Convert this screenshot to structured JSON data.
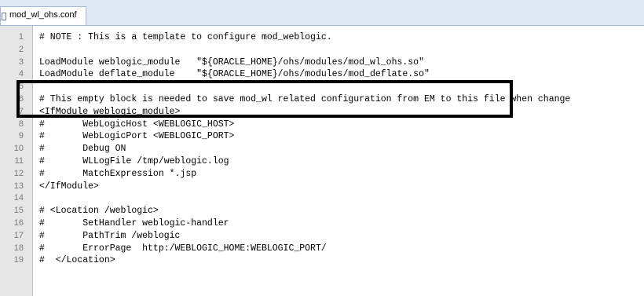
{
  "tab": {
    "icon": "file-icon",
    "label": "mod_wl_ohs.conf"
  },
  "lines": [
    {
      "num": "1",
      "text": "# NOTE : This is a template to configure mod_weblogic."
    },
    {
      "num": "2",
      "text": ""
    },
    {
      "num": "3",
      "text": "LoadModule weblogic_module   \"${ORACLE_HOME}/ohs/modules/mod_wl_ohs.so\""
    },
    {
      "num": "4",
      "text": "LoadModule deflate_module    \"${ORACLE_HOME}/ohs/modules/mod_deflate.so\""
    },
    {
      "num": "5",
      "text": ""
    },
    {
      "num": "6",
      "text": "# This empty block is needed to save mod_wl related configuration from EM to this file when change"
    },
    {
      "num": "7",
      "text": "<IfModule weblogic_module>"
    },
    {
      "num": "8",
      "text": "#       WebLogicHost <WEBLOGIC_HOST>"
    },
    {
      "num": "9",
      "text": "#       WebLogicPort <WEBLOGIC_PORT>"
    },
    {
      "num": "10",
      "text": "#       Debug ON"
    },
    {
      "num": "11",
      "text": "#       WLLogFile /tmp/weblogic.log"
    },
    {
      "num": "12",
      "text": "#       MatchExpression *.jsp"
    },
    {
      "num": "13",
      "text": "</IfModule>"
    },
    {
      "num": "14",
      "text": ""
    },
    {
      "num": "15",
      "text": "# <Location /weblogic>"
    },
    {
      "num": "16",
      "text": "#       SetHandler weblogic-handler"
    },
    {
      "num": "17",
      "text": "#       PathTrim /weblogic"
    },
    {
      "num": "18",
      "text": "#       ErrorPage  http:/WEBLOGIC_HOME:WEBLOGIC_PORT/"
    },
    {
      "num": "19",
      "text": "#  </Location>"
    }
  ]
}
